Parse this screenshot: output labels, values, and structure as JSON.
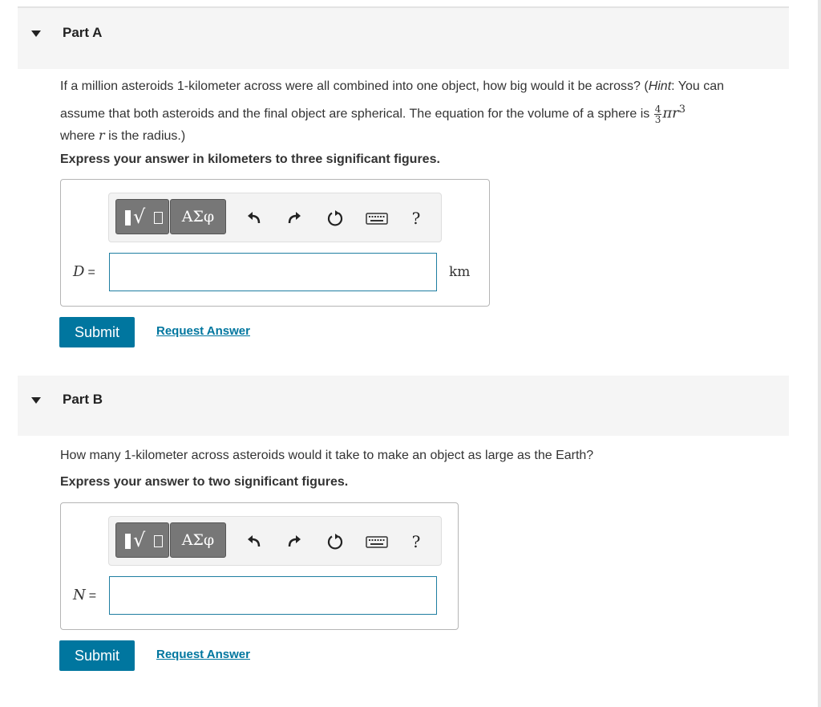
{
  "partA": {
    "title": "Part A",
    "question_p1": "If a million asteroids 1-kilometer across were all combined into one object, how big would it be across? (",
    "hint_label": "Hint",
    "question_p2": ": You can",
    "question_line2": "assume that both asteroids and the final object are spherical. The equation for the volume of a sphere is ",
    "frac_num": "4",
    "frac_den": "3",
    "formula_pi_r": "πr",
    "formula_exp": "3",
    "question_line3_pre": "where ",
    "question_var_r": "r",
    "question_line3_post": " is the radius.)",
    "instruction": "Express your answer in kilometers to three significant figures.",
    "variable": "D",
    "equals": "=",
    "input_value": "",
    "unit": "km",
    "submit_label": "Submit",
    "request_label": "Request Answer"
  },
  "partB": {
    "title": "Part B",
    "question": "How many 1-kilometer across asteroids would it take to make an object as large as the Earth?",
    "instruction": "Express your answer to two significant figures.",
    "variable": "N",
    "equals": "=",
    "input_value": "",
    "submit_label": "Submit",
    "request_label": "Request Answer"
  },
  "toolbar": {
    "greek_label": "ΑΣφ",
    "help_label": "?",
    "icons": [
      "templates-icon",
      "greek-letters-icon",
      "undo-icon",
      "redo-icon",
      "reset-icon",
      "keyboard-icon",
      "help-icon"
    ]
  },
  "colors": {
    "accent": "#00769f",
    "header_bg": "#f5f5f5",
    "toolbar_btn": "#777777"
  }
}
